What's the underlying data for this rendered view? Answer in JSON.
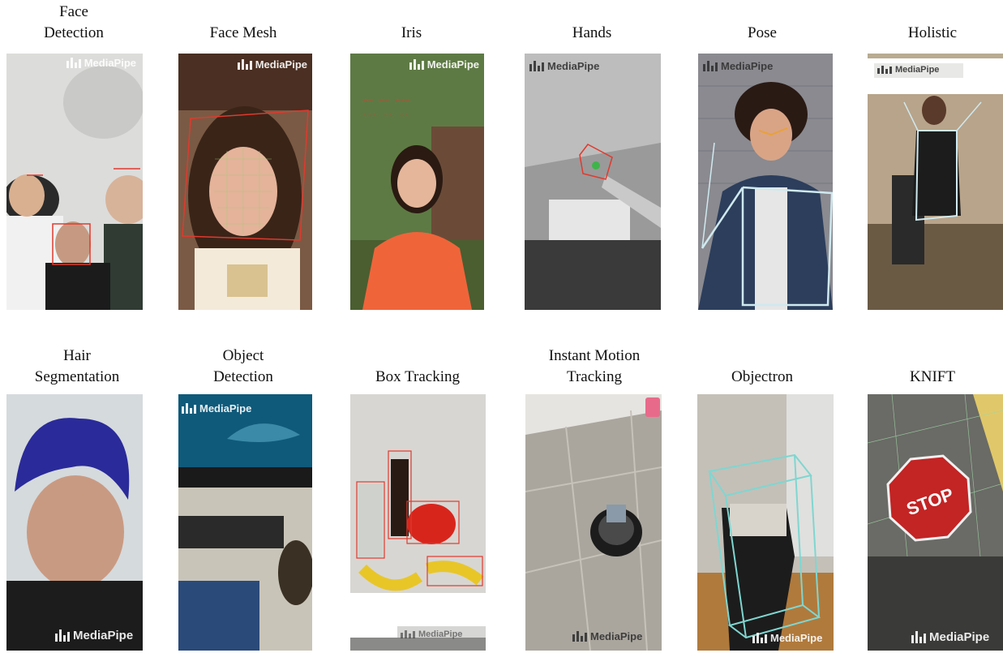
{
  "logo_text": "MediaPipe",
  "rows": [
    {
      "panels": [
        {
          "label_lines": [
            "Face",
            "Detection"
          ]
        },
        {
          "label_lines": [
            "Face Mesh"
          ]
        },
        {
          "label_lines": [
            "Iris"
          ]
        },
        {
          "label_lines": [
            "Hands"
          ]
        },
        {
          "label_lines": [
            "Pose"
          ]
        },
        {
          "label_lines": [
            "Holistic"
          ]
        }
      ]
    },
    {
      "panels": [
        {
          "label_lines": [
            "Hair",
            "Segmentation"
          ]
        },
        {
          "label_lines": [
            "Object",
            "Detection"
          ]
        },
        {
          "label_lines": [
            "Box Tracking"
          ]
        },
        {
          "label_lines": [
            "Instant Motion",
            "Tracking"
          ]
        },
        {
          "label_lines": [
            "Objectron"
          ]
        },
        {
          "label_lines": [
            "KNIFT"
          ]
        }
      ]
    }
  ],
  "stop_sign_text": "STOP",
  "colors": {
    "annotation_red": "#e03a2e",
    "pose_line": "#cfe9ef",
    "box_cyan": "#7fd6d0"
  }
}
